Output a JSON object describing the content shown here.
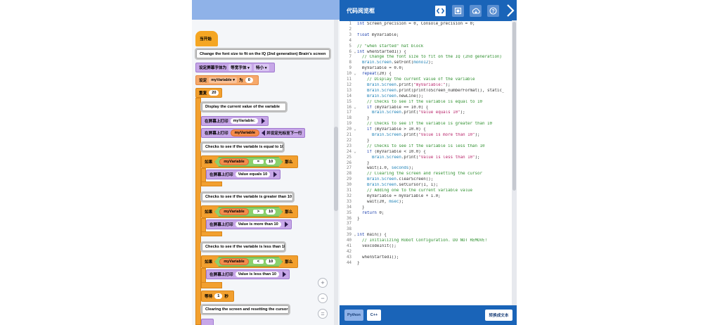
{
  "blocks": {
    "when_started": "当开始",
    "comment_font": "Change the font size to fit on the IQ (2nd generation) Brain's screen",
    "set_font": {
      "label": "设定屏幕字体为",
      "font": "等宽字体",
      "size": "特小"
    },
    "set_var": {
      "label": "设定",
      "var": "myVariable",
      "to": "为",
      "value": "0"
    },
    "repeat": {
      "label": "重复",
      "times": "20"
    },
    "comment_display": "Display the current value of the variable",
    "print1": {
      "label": "在屏幕上打印",
      "value": "myVariable:"
    },
    "print2": {
      "label": "在屏幕上打印",
      "var": "myVariable",
      "suffix": "并设定光标至下一行"
    },
    "comment_equal": "Checks to see if the variable is equal to 10",
    "if_eq": {
      "if": "如果",
      "var": "myVariable",
      "op": "=",
      "value": "10",
      "then": "那么"
    },
    "print_eq": {
      "label": "在屏幕上打印",
      "value": "Value equals 10"
    },
    "comment_greater": "Checks to see if the variable is greater than 10",
    "if_gt": {
      "if": "如果",
      "var": "myVariable",
      "op": ">",
      "value": "10",
      "then": "那么"
    },
    "print_gt": {
      "label": "在屏幕上打印",
      "value": "Value is more than 10"
    },
    "comment_less": "Checks to see if the variable is less than 10",
    "if_lt": {
      "if": "如果",
      "var": "myVariable",
      "op": "<",
      "value": "10",
      "then": "那么"
    },
    "print_lt": {
      "label": "在屏幕上打印",
      "value": "Value is less than 10"
    },
    "wait": {
      "label": "等待",
      "value": "1",
      "unit": "秒"
    },
    "comment_clear": "Clearing the screen and resetting the cursor"
  },
  "zoom": {
    "in": "+",
    "out": "−",
    "reset": "="
  },
  "viewer": {
    "title": "代码阅览框",
    "buttons": [
      "code-icon",
      "device-icon",
      "download-icon",
      "help-icon"
    ],
    "colors": {
      "header": "#1a64b8",
      "accent": "#8fb2e8"
    }
  },
  "code": [
    {
      "n": "1",
      "f": "",
      "t": "int Screen_precision = 0, Console_precision = 0;"
    },
    {
      "n": "2",
      "f": "",
      "t": ""
    },
    {
      "n": "3",
      "f": "",
      "t": "float myVariable;"
    },
    {
      "n": "4",
      "f": "",
      "t": ""
    },
    {
      "n": "5",
      "f": "",
      "t": "// \"when started\" hat block"
    },
    {
      "n": "6",
      "f": "v",
      "t": "int whenStarted1() {"
    },
    {
      "n": "7",
      "f": "",
      "t": "  // Change the font size to fit on the IQ (2nd generation)"
    },
    {
      "n": "8",
      "f": "",
      "t": "  Brain.Screen.setFont(mono12);"
    },
    {
      "n": "9",
      "f": "",
      "t": "  myVariable = 0.0;"
    },
    {
      "n": "10",
      "f": "v",
      "t": "  repeat(20) {"
    },
    {
      "n": "11",
      "f": "",
      "t": "    // Display the current value of the variable"
    },
    {
      "n": "12",
      "f": "",
      "t": "    Brain.Screen.print(\"myVariable:\");"
    },
    {
      "n": "13",
      "f": "",
      "t": "    Brain.Screen.print(printToScreen_numberFormat(), static_"
    },
    {
      "n": "14",
      "f": "",
      "t": "    Brain.Screen.newLine();"
    },
    {
      "n": "15",
      "f": "",
      "t": "    // Checks to see if the variable is equal to 10"
    },
    {
      "n": "16",
      "f": "v",
      "t": "    if (myVariable == 10.0) {"
    },
    {
      "n": "17",
      "f": "",
      "t": "      Brain.Screen.print(\"Value equals 10\");"
    },
    {
      "n": "18",
      "f": "",
      "t": "    }"
    },
    {
      "n": "19",
      "f": "",
      "t": "    // Checks to see if the variable is greater than 10"
    },
    {
      "n": "20",
      "f": "v",
      "t": "    if (myVariable > 10.0) {"
    },
    {
      "n": "21",
      "f": "",
      "t": "      Brain.Screen.print(\"Value is more than 10\");"
    },
    {
      "n": "22",
      "f": "",
      "t": "    }"
    },
    {
      "n": "23",
      "f": "",
      "t": "    // Checks to see if the variable is less than 10"
    },
    {
      "n": "24",
      "f": "v",
      "t": "    if (myVariable < 10.0) {"
    },
    {
      "n": "25",
      "f": "",
      "t": "      Brain.Screen.print(\"Value is less than 10\");"
    },
    {
      "n": "26",
      "f": "",
      "t": "    }"
    },
    {
      "n": "27",
      "f": "",
      "t": "    wait(1.0, seconds);"
    },
    {
      "n": "28",
      "f": "",
      "t": "    // Clearing the screen and resetting the cursor"
    },
    {
      "n": "29",
      "f": "",
      "t": "    Brain.Screen.clearScreen();"
    },
    {
      "n": "30",
      "f": "",
      "t": "    Brain.Screen.setCursor(1, 1);"
    },
    {
      "n": "31",
      "f": "",
      "t": "    // Adding one to the current variable value"
    },
    {
      "n": "32",
      "f": "",
      "t": "    myVariable = myVariable + 1.0;"
    },
    {
      "n": "33",
      "f": "",
      "t": "    wait(20, msec);"
    },
    {
      "n": "34",
      "f": "",
      "t": "  }"
    },
    {
      "n": "35",
      "f": "",
      "t": "  return 0;"
    },
    {
      "n": "36",
      "f": "",
      "t": "}"
    },
    {
      "n": "37",
      "f": "",
      "t": ""
    },
    {
      "n": "38",
      "f": "",
      "t": ""
    },
    {
      "n": "39",
      "f": "v",
      "t": "int main() {"
    },
    {
      "n": "40",
      "f": "",
      "t": "  // Initializing Robot Configuration. DO NOT REMOVE!"
    },
    {
      "n": "41",
      "f": "",
      "t": "  vexcodeInit();"
    },
    {
      "n": "42",
      "f": "",
      "t": ""
    },
    {
      "n": "43",
      "f": "",
      "t": "  whenStarted1();"
    },
    {
      "n": "44",
      "f": "",
      "t": "}"
    }
  ],
  "footer": {
    "python": "Python",
    "cpp": "C++",
    "convert": "转换成文本"
  }
}
